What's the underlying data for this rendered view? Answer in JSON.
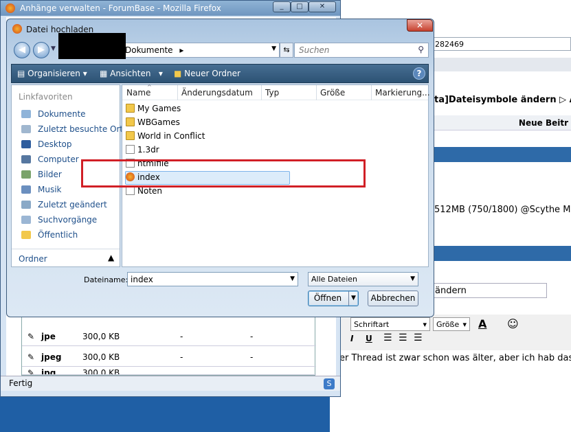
{
  "background_page": {
    "url_fragment": "282469",
    "thread_heading": "ta]Dateisymbole ändern ▷ Auf",
    "new_post_label": "Neue Beitr",
    "spec_text": "512MB (750/1800) @Scythe Mus",
    "subject_value": "ändern",
    "font_select": "Schriftart",
    "size_select": "Größe",
    "message_text": "er Thread ist zwar schon was älter, aber ich hab das e"
  },
  "firefox": {
    "window_title": "Anhänge verwalten - ForumBase - Mozilla Firefox",
    "status_text": "Fertig",
    "table_rows": [
      {
        "ext": "jpe",
        "size": "300,0 KB",
        "c3": "-",
        "c4": "-"
      },
      {
        "ext": "jpeg",
        "size": "300,0 KB",
        "c3": "-",
        "c4": "-"
      },
      {
        "ext": "jpg",
        "size": "300,0 KB",
        "c3": "",
        "c4": ""
      }
    ]
  },
  "dialog": {
    "title": "Datei hochladen",
    "breadcrumb": "Dokumente",
    "search_placeholder": "Suchen",
    "toolbar": {
      "organize": "Organisieren",
      "views": "Ansichten",
      "new_folder": "Neuer Ordner"
    },
    "favorites_header": "Linkfavoriten",
    "favorites": [
      {
        "label": "Dokumente",
        "icon": "documents-icon"
      },
      {
        "label": "Zuletzt besuchte Orte",
        "icon": "recent-places-icon"
      },
      {
        "label": "Desktop",
        "icon": "desktop-icon"
      },
      {
        "label": "Computer",
        "icon": "computer-icon"
      },
      {
        "label": "Bilder",
        "icon": "pictures-icon"
      },
      {
        "label": "Musik",
        "icon": "music-icon"
      },
      {
        "label": "Zuletzt geändert",
        "icon": "recently-changed-icon"
      },
      {
        "label": "Suchvorgänge",
        "icon": "searches-icon"
      },
      {
        "label": "Öffentlich",
        "icon": "public-folder-icon"
      }
    ],
    "folders_label": "Ordner",
    "columns": [
      "Name",
      "Änderungsdatum",
      "Typ",
      "Größe",
      "Markierung..."
    ],
    "files": [
      {
        "name": "My Games",
        "kind": "folder"
      },
      {
        "name": "WBGames",
        "kind": "folder"
      },
      {
        "name": "World in Conflict",
        "kind": "folder"
      },
      {
        "name": "1.3dr",
        "kind": "file"
      },
      {
        "name": "htmlfile",
        "kind": "file"
      },
      {
        "name": "index",
        "kind": "html"
      },
      {
        "name": "Noten",
        "kind": "file"
      }
    ],
    "selected_file": "index",
    "filename_label": "Dateiname:",
    "filename_value": "index",
    "filter_value": "Alle Dateien",
    "open_button": "Öffnen",
    "cancel_button": "Abbrechen"
  },
  "colors": {
    "annotation_red": "#d11f26",
    "toolbar_blue": "#2c5274",
    "link_blue": "#1e4f8a"
  }
}
